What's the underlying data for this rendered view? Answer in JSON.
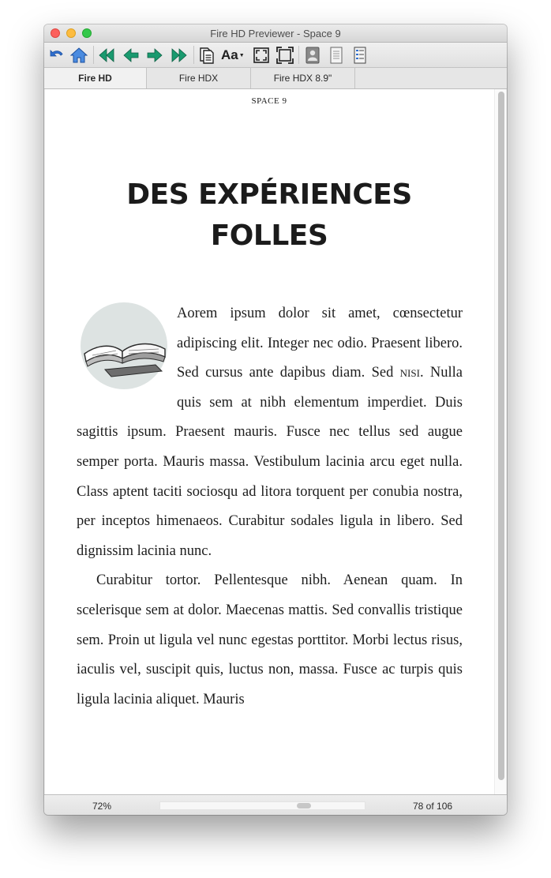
{
  "window": {
    "title": "Fire HD Previewer - Space 9"
  },
  "toolbar": {
    "buttons": [
      {
        "name": "undo-icon"
      },
      {
        "name": "home-icon"
      },
      {
        "name": "first-page-icon"
      },
      {
        "name": "previous-page-icon"
      },
      {
        "name": "next-page-icon"
      },
      {
        "name": "last-page-icon"
      },
      {
        "name": "document-icon"
      },
      {
        "name": "font-size-icon",
        "label": "Aa"
      },
      {
        "name": "fit-page-icon"
      },
      {
        "name": "full-screen-icon"
      },
      {
        "name": "profile-image-icon"
      },
      {
        "name": "page-view-icon"
      },
      {
        "name": "toc-icon"
      }
    ]
  },
  "tabs": [
    {
      "label": "Fire HD",
      "active": true
    },
    {
      "label": "Fire HDX",
      "active": false
    },
    {
      "label": "Fire HDX 8.9\"",
      "active": false
    }
  ],
  "book": {
    "header": "SPACE 9",
    "chapter_title_line1": "DES EXPÉRIENCES",
    "chapter_title_line2": "FOLLES",
    "image_icon": "open-book-illustration",
    "p1_start": "Aorem ipsum dolor sit amet, cœnsectetur adipiscing elit. Integer nec odio. Praesent libero. Sed cursus ante dapibus diam. Sed ",
    "p1_nisi": "nisi",
    "p1_end": ". Nulla quis sem at nibh elementum imperdiet. Duis sagittis ipsum. Praesent mauris. Fusce nec tellus sed augue semper porta. Mauris massa. Vestibulum lacinia arcu eget nulla. Class aptent taciti sociosqu ad litora torquent per conubia nostra, per inceptos himenaeos. Curabitur sodales ligula in libero. Sed dignissim lacinia nunc.",
    "p2": "Curabitur tortor. Pellentesque nibh. Aenean quam. In scelerisque sem at dolor. Maecenas mattis. Sed convallis tristique sem. Proin ut ligula vel nunc egestas porttitor. Morbi lectus risus, iaculis vel, suscipit quis, luctus non, massa. Fusce ac turpis quis ligula lacinia aliquet. Mauris"
  },
  "status": {
    "zoom": "72%",
    "page": "78 of 106"
  },
  "colors": {
    "accent_blue": "#2f6fcf",
    "nav_green": "#1a9a6f",
    "close": "#fc605c",
    "minimize": "#fdbc40",
    "maximize": "#34c84a"
  }
}
